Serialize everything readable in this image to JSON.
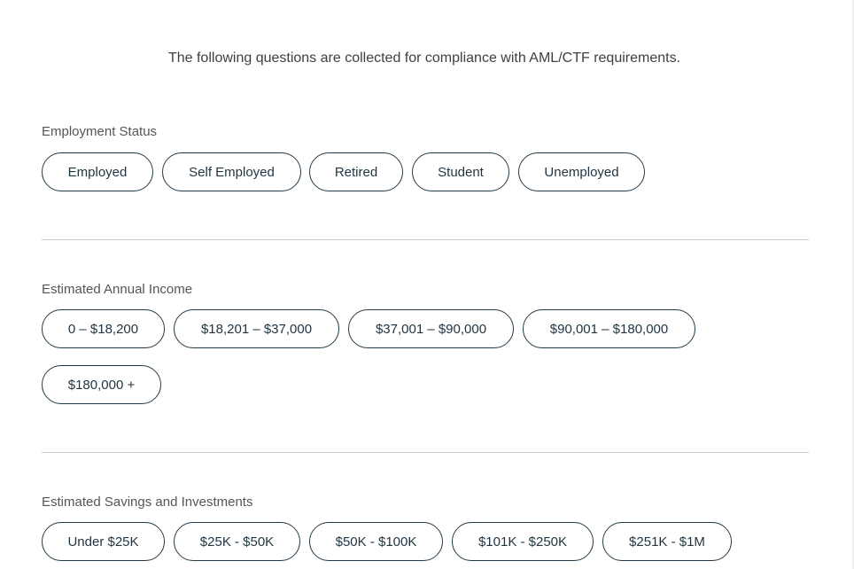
{
  "intro_text": "The following questions are collected for compliance with AML/CTF requirements.",
  "sections": [
    {
      "label": "Employment Status",
      "options": [
        "Employed",
        "Self Employed",
        "Retired",
        "Student",
        "Unemployed"
      ]
    },
    {
      "label": "Estimated Annual Income",
      "options": [
        "0 – $18,200",
        "$18,201 – $37,000",
        "$37,001 – $90,000",
        "$90,001 – $180,000",
        "$180,000 +"
      ]
    },
    {
      "label": "Estimated Savings and Investments",
      "options": [
        "Under $25K",
        "$25K - $50K",
        "$50K - $100K",
        "$101K - $250K",
        "$251K - $1M"
      ]
    }
  ],
  "colors": {
    "pill_border": "#233a46",
    "pill_text": "#1f3440",
    "label_text": "#555555",
    "divider": "#c9c9c9"
  }
}
